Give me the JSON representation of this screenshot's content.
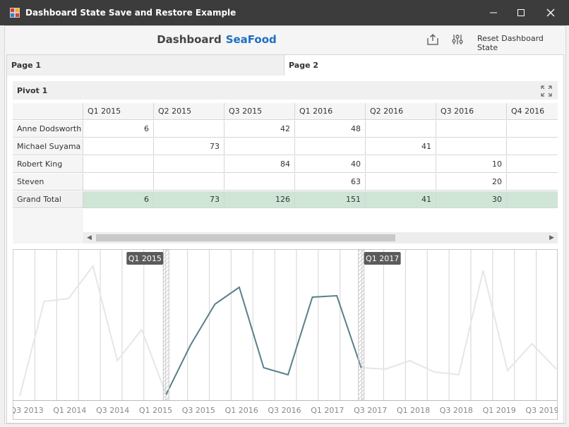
{
  "window": {
    "title": "Dashboard State Save and Restore Example"
  },
  "header": {
    "title_part1": "Dashboard",
    "title_part2": "SeaFood",
    "reset_label": "Reset Dashboard State",
    "export_icon": "export-icon",
    "parameters_icon": "parameters-icon"
  },
  "tabs": [
    {
      "label": "Page 1",
      "selected": false
    },
    {
      "label": "Page 2",
      "selected": true
    }
  ],
  "pivot": {
    "caption": "Pivot 1",
    "maximize_icon": "maximize-icon",
    "columns": [
      "Q1 2015",
      "Q2 2015",
      "Q3 2015",
      "Q1 2016",
      "Q2 2016",
      "Q3 2016",
      "Q4 2016"
    ],
    "rows": [
      {
        "name": "Anne Dodsworth",
        "values": [
          "6",
          "",
          "42",
          "48",
          "",
          "",
          ""
        ]
      },
      {
        "name": "Michael Suyama",
        "values": [
          "",
          "73",
          "",
          "",
          "41",
          "",
          ""
        ]
      },
      {
        "name": "Robert King",
        "values": [
          "",
          "",
          "84",
          "40",
          "",
          "10",
          ""
        ]
      },
      {
        "name": "Steven Buchanan",
        "values": [
          "",
          "",
          "",
          "63",
          "",
          "20",
          ""
        ]
      }
    ],
    "total": {
      "name": "Grand Total",
      "values": [
        "6",
        "73",
        "126",
        "151",
        "41",
        "30",
        ""
      ]
    }
  },
  "range_filter": {
    "selection_start_label": "Q1 2015",
    "selection_end_label": "Q1 2017",
    "selection_start_index": 6,
    "selection_end_index": 14,
    "axis_labels": [
      "Q3 2013",
      "Q1 2014",
      "Q3 2014",
      "Q1 2015",
      "Q3 2015",
      "Q1 2016",
      "Q3 2016",
      "Q1 2017",
      "Q3 2017",
      "Q1 2018",
      "Q3 2018",
      "Q1 2019",
      "Q3 2019"
    ],
    "series_values": [
      3,
      70,
      72,
      95,
      28,
      50,
      4,
      39,
      68,
      80,
      23,
      18,
      73,
      74,
      23,
      22,
      28,
      20,
      18,
      92,
      21,
      40,
      22
    ],
    "colors": {
      "selected_line": "#5b7f8a",
      "faded_line": "#e6e6e6",
      "grid": "#d4d4d4",
      "tag_bg": "#5b5b5b"
    }
  }
}
